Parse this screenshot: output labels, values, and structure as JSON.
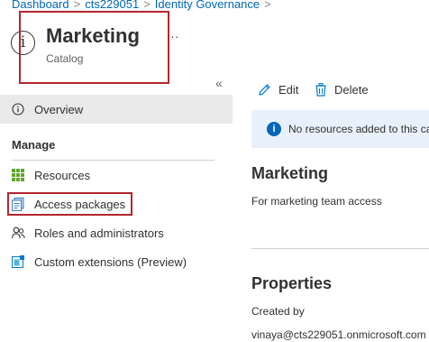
{
  "breadcrumb": {
    "items": [
      "Dashboard",
      "cts229051",
      "Identity Governance"
    ],
    "separator": ">"
  },
  "header": {
    "title": "Marketing",
    "subtitle": "Catalog",
    "more": "..."
  },
  "sidebar": {
    "collapse": "«",
    "overview": "Overview",
    "manage_heading": "Manage",
    "items": [
      {
        "label": "Resources",
        "icon": "grid-icon"
      },
      {
        "label": "Access packages",
        "icon": "package-icon"
      },
      {
        "label": "Roles and administrators",
        "icon": "people-icon"
      },
      {
        "label": "Custom extensions (Preview)",
        "icon": "extension-icon"
      }
    ]
  },
  "toolbar": {
    "edit_label": "Edit",
    "delete_label": "Delete"
  },
  "banner": {
    "text": "No resources added to this catalog"
  },
  "main": {
    "name_heading": "Marketing",
    "description": "For marketing team access",
    "properties_heading": "Properties",
    "created_by_label": "Created by",
    "created_by_value": "vinaya@cts229051.onmicrosoft.com"
  },
  "colors": {
    "accent": "#0067b8",
    "highlight_border": "#b4262e",
    "selected_bg": "#e9e9e9",
    "banner_bg": "#e8f1fb"
  }
}
